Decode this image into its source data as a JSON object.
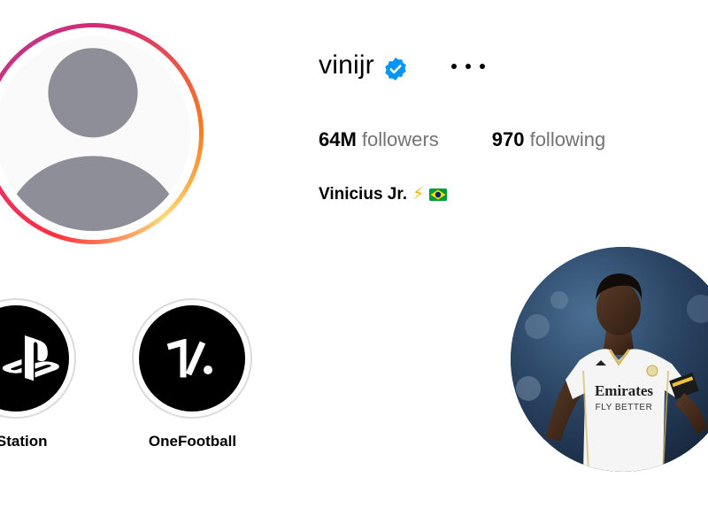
{
  "profile": {
    "username": "vinijr",
    "verified": true,
    "followers_count": "64M",
    "followers_label": "followers",
    "following_count": "970",
    "following_label": "following",
    "full_name": "Vinicius Jr.",
    "bio_emojis": [
      "lightning-bolt",
      "brazil-flag"
    ]
  },
  "highlights": [
    {
      "label": "yStation",
      "icon": "playstation-logo"
    },
    {
      "label": "OneFootball",
      "icon": "onefootball-logo"
    }
  ],
  "photo": {
    "jersey_text_1": "Emirates",
    "jersey_text_2": "FLY BETTER"
  },
  "colors": {
    "verified_blue": "#0095f6",
    "secondary_text": "#737373",
    "highlight_border": "#dbdbdb"
  }
}
